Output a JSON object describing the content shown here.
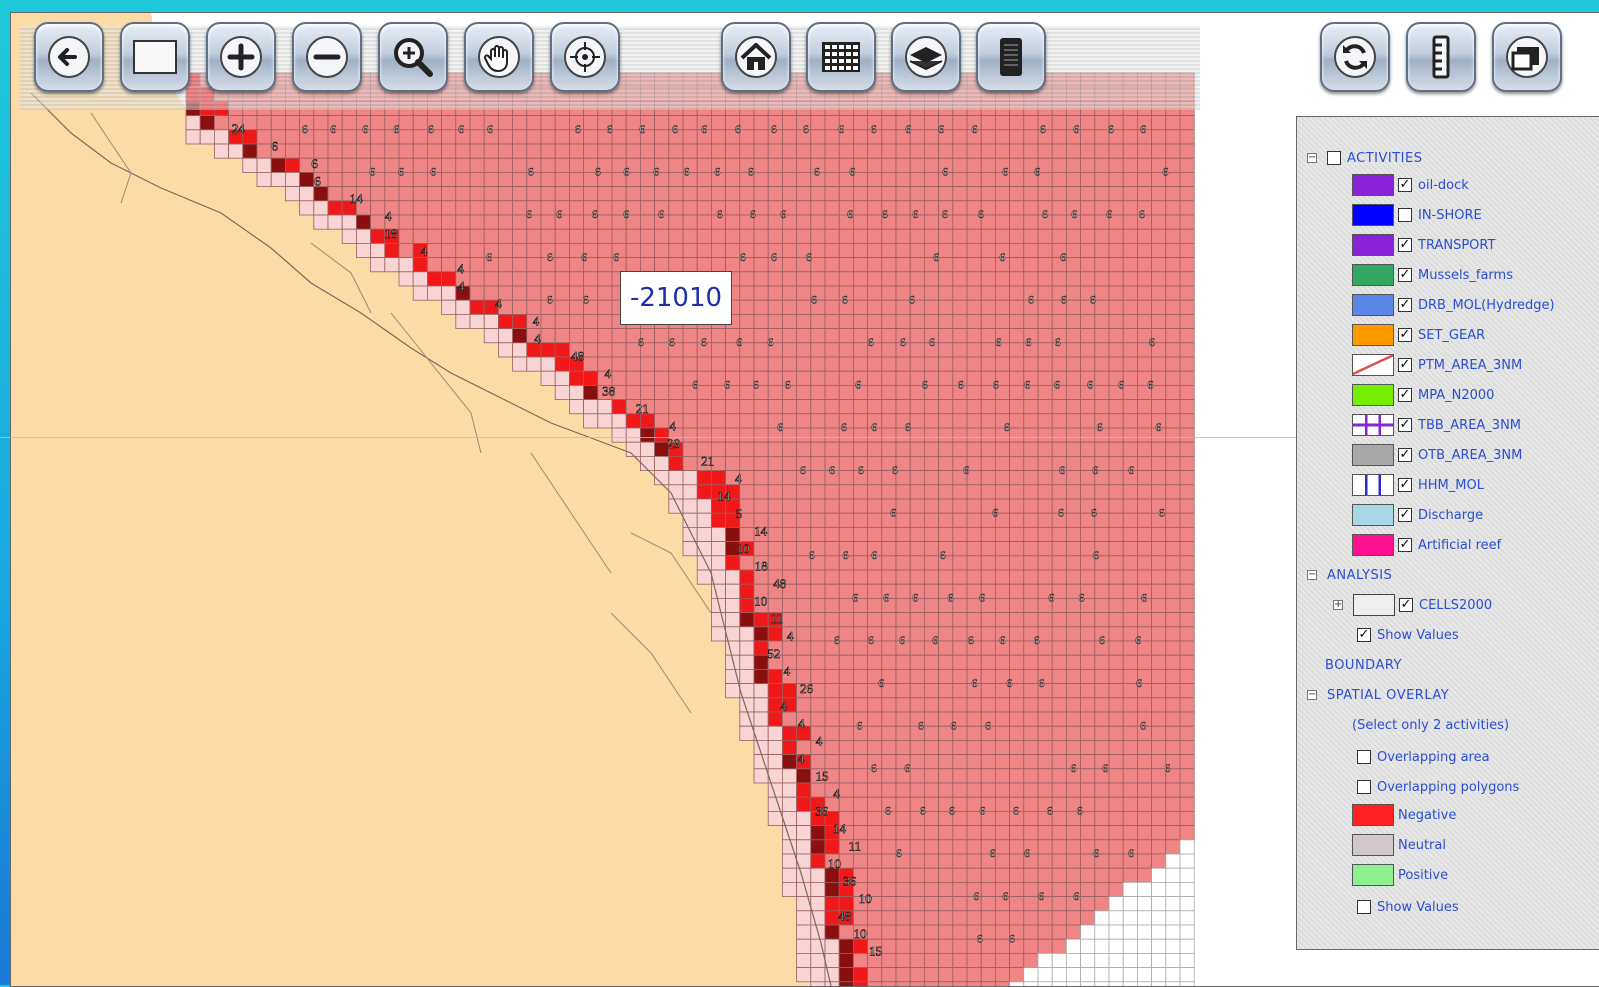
{
  "toolbar": {
    "left_buttons": [
      {
        "name": "back-button",
        "icon": "arrow-left-icon"
      },
      {
        "name": "full-extent-button",
        "icon": "rectangle-icon"
      },
      {
        "name": "zoom-in-button",
        "icon": "plus-icon"
      },
      {
        "name": "zoom-out-button",
        "icon": "minus-icon"
      },
      {
        "name": "zoom-box-button",
        "icon": "magnifier-icon"
      },
      {
        "name": "pan-button",
        "icon": "hand-icon"
      },
      {
        "name": "identify-button",
        "icon": "crosshair-icon"
      }
    ],
    "center_buttons": [
      {
        "name": "home-button",
        "icon": "home-icon"
      },
      {
        "name": "grid-button",
        "icon": "grid-icon"
      },
      {
        "name": "layers-button",
        "icon": "layers-icon"
      },
      {
        "name": "document-button",
        "icon": "document-icon"
      }
    ],
    "right_buttons": [
      {
        "name": "refresh-button",
        "icon": "refresh-icon"
      },
      {
        "name": "ruler-button",
        "icon": "ruler-icon"
      },
      {
        "name": "window-button",
        "icon": "window-icon"
      }
    ]
  },
  "tooltip": {
    "value": "-21010"
  },
  "map_labels": {
    "left": [
      "24",
      "6",
      "6",
      "6",
      "14",
      "4",
      "18",
      "4",
      "4",
      "4",
      "4",
      "4",
      "4",
      "48",
      "4",
      "38",
      "21",
      "4",
      "29",
      "21",
      "4",
      "14",
      "5",
      "14",
      "10",
      "18",
      "48",
      "10",
      "11",
      "4",
      "52",
      "4",
      "26",
      "4",
      "4",
      "4",
      "4",
      "15",
      "4",
      "36",
      "14",
      "11",
      "10",
      "36",
      "10",
      "48",
      "10",
      "15"
    ],
    "fill_value": "6"
  },
  "legend": {
    "activities": {
      "header": "ACTIVITIES",
      "checked": false,
      "items": [
        {
          "label": "oil-dock",
          "color": "#8a22d8",
          "pattern": "solid",
          "checked": true
        },
        {
          "label": "IN-SHORE",
          "color": "#0000ff",
          "pattern": "solid",
          "checked": false
        },
        {
          "label": "TRANSPORT",
          "color": "#8a22d8",
          "pattern": "solid",
          "checked": true
        },
        {
          "label": "Mussels_farms",
          "color": "#33a860",
          "pattern": "solid",
          "checked": true
        },
        {
          "label": "DRB_MOL(Hydredge)",
          "color": "#5a86e8",
          "pattern": "solid",
          "checked": true
        },
        {
          "label": "SET_GEAR",
          "color": "#ff9900",
          "pattern": "solid",
          "checked": true
        },
        {
          "label": "PTM_AREA_3NM",
          "color": "#e05050",
          "pattern": "hatch",
          "checked": true
        },
        {
          "label": "MPA_N2000",
          "color": "#77ee00",
          "pattern": "solid",
          "checked": true
        },
        {
          "label": "TBB_AREA_3NM",
          "color": "#8a22d8",
          "pattern": "cross",
          "checked": true
        },
        {
          "label": "OTB_AREA_3NM",
          "color": "#a8a8a8",
          "pattern": "solid",
          "checked": true
        },
        {
          "label": "HHM_MOL",
          "color": "#2a2ad0",
          "pattern": "vlines",
          "checked": true
        },
        {
          "label": "Discharge",
          "color": "#a8d8e6",
          "pattern": "solid",
          "checked": true
        },
        {
          "label": "Artificial reef",
          "color": "#ff1090",
          "pattern": "solid",
          "checked": true
        }
      ]
    },
    "analysis": {
      "header": "ANALYSIS",
      "cells_label": "CELLS2000",
      "cells_checked": true,
      "show_values_label": "Show Values",
      "show_values_checked": true
    },
    "boundary": {
      "header": "BOUNDARY"
    },
    "spatial_overlay": {
      "header": "SPATIAL OVERLAY",
      "note": "(Select only 2 activities)",
      "options": [
        {
          "label": "Overlapping area",
          "checked": false
        },
        {
          "label": "Overlapping polygons",
          "checked": false
        }
      ],
      "classes": [
        {
          "label": "Negative",
          "color": "#ff2020"
        },
        {
          "label": "Neutral",
          "color": "#d0c8cc"
        },
        {
          "label": "Positive",
          "color": "#90f090"
        }
      ],
      "show_values_label": "Show Values",
      "show_values_checked": false
    }
  },
  "colors": {
    "land": "#fddba6",
    "sea": "#ffffff",
    "cell_pink": "#ef8585",
    "cell_red": "#f01818",
    "cell_dark": "#8a1010",
    "cell_light": "#f8d4d4",
    "grid": "#9a6060",
    "legend_text": "#2a4fd0"
  }
}
